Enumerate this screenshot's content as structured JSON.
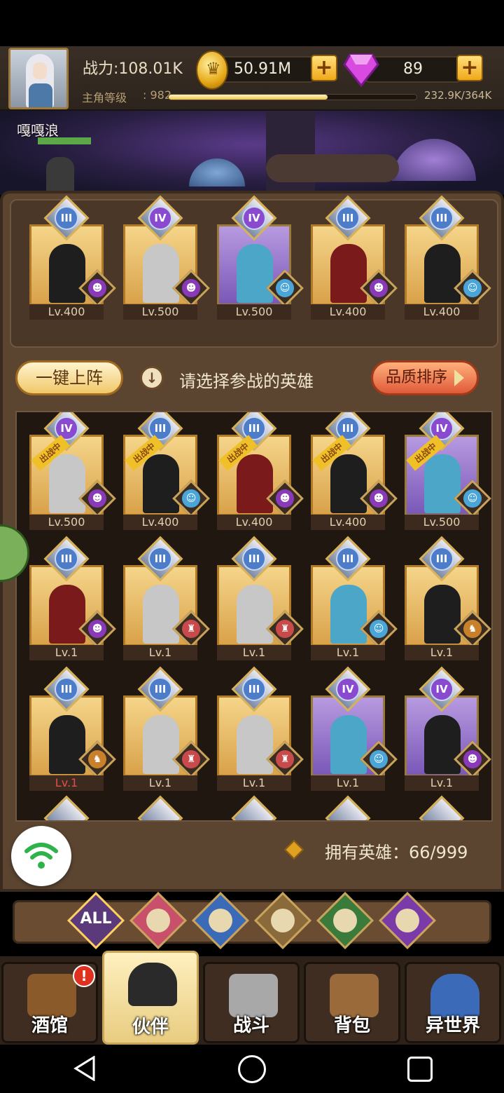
{
  "player": {
    "power": "战力:108.01K",
    "level_label": "主角等级",
    "level_value": ": 982",
    "xp_text": "232.9K/364K",
    "xp_progress": 0.64,
    "gold": "50.91M",
    "gems": "89",
    "hero_name": "嘎嘎浪"
  },
  "lineup": [
    {
      "rank": "III",
      "level": "Lv.400",
      "faction": "demon"
    },
    {
      "rank": "IV",
      "level": "Lv.500",
      "faction": "demon"
    },
    {
      "rank": "IV",
      "level": "Lv.500",
      "faction": "elf"
    },
    {
      "rank": "III",
      "level": "Lv.400",
      "faction": "demon"
    },
    {
      "rank": "III",
      "level": "Lv.400",
      "faction": "elf"
    }
  ],
  "controls": {
    "auto_button": "一键上阵",
    "hint": "请选择参战的英雄",
    "sort_button": "品质排序"
  },
  "heroes": {
    "in_battle_label": "出战中",
    "row1": [
      {
        "rank": "IV",
        "level": "Lv.500",
        "in_battle": true
      },
      {
        "rank": "III",
        "level": "Lv.400",
        "in_battle": true
      },
      {
        "rank": "III",
        "level": "Lv.400",
        "in_battle": true
      },
      {
        "rank": "III",
        "level": "Lv.400",
        "in_battle": true
      },
      {
        "rank": "IV",
        "level": "Lv.500",
        "in_battle": true
      }
    ],
    "row2": [
      {
        "rank": "III",
        "level": "Lv.1"
      },
      {
        "rank": "III",
        "level": "Lv.1"
      },
      {
        "rank": "III",
        "level": "Lv.1"
      },
      {
        "rank": "III",
        "level": "Lv.1"
      },
      {
        "rank": "III",
        "level": "Lv.1"
      }
    ],
    "row3": [
      {
        "rank": "III",
        "level": "Lv.1"
      },
      {
        "rank": "III",
        "level": "Lv.1"
      },
      {
        "rank": "III",
        "level": "Lv.1"
      },
      {
        "rank": "IV",
        "level": "Lv.1"
      },
      {
        "rank": "IV",
        "level": "Lv.1"
      }
    ]
  },
  "owned": "拥有英雄：66/999",
  "filters": [
    "ALL",
    "human",
    "elf",
    "beast",
    "nature",
    "demon"
  ],
  "nav": {
    "tavern": "酒馆",
    "partner": "伙伴",
    "battle": "战斗",
    "bag": "背包",
    "otherworld": "异世界",
    "tavern_badge": "!"
  },
  "colors": {
    "gold_accent": "#f0c44a",
    "panel": "#5b4531",
    "rank3": "#4d7cc8",
    "rank4": "#8a4ad0"
  }
}
